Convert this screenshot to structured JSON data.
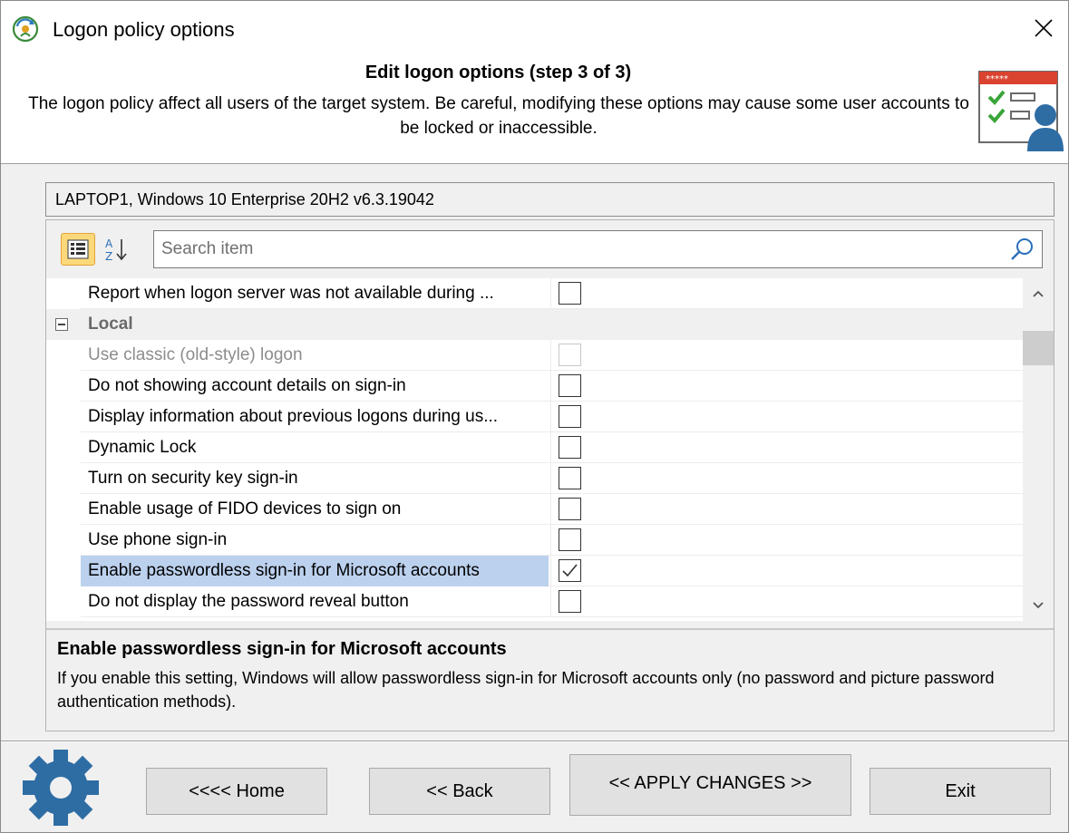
{
  "window": {
    "title": "Logon policy options"
  },
  "header": {
    "title": "Edit logon options (step 3 of 3)",
    "description": "The logon policy affect all users of the target system. Be careful, modifying these options may cause some user accounts to be locked or inaccessible."
  },
  "system_info": "LAPTOP1, Windows 10 Enterprise 20H2 v6.3.19042",
  "search": {
    "placeholder": "Search item",
    "value": ""
  },
  "rows": [
    {
      "label": "Report when logon server was not available during ...",
      "checked": false,
      "state": "normal"
    },
    {
      "label": "Local",
      "state": "category",
      "expanded": true
    },
    {
      "label": "Use classic (old-style) logon",
      "checked": false,
      "state": "disabled"
    },
    {
      "label": "Do not showing account details on sign-in",
      "checked": false,
      "state": "normal"
    },
    {
      "label": "Display information about previous logons during us...",
      "checked": false,
      "state": "normal"
    },
    {
      "label": "Dynamic Lock",
      "checked": false,
      "state": "normal"
    },
    {
      "label": "Turn on security key sign-in",
      "checked": false,
      "state": "normal"
    },
    {
      "label": "Enable usage of FIDO devices to sign on",
      "checked": false,
      "state": "normal"
    },
    {
      "label": "Use phone sign-in",
      "checked": false,
      "state": "normal"
    },
    {
      "label": "Enable passwordless sign-in for Microsoft accounts",
      "checked": true,
      "state": "selected"
    },
    {
      "label": "Do not display the password reveal button",
      "checked": false,
      "state": "normal"
    }
  ],
  "description_panel": {
    "title": "Enable passwordless sign-in for Microsoft accounts",
    "text": "If you enable this setting, Windows will allow passwordless sign-in for Microsoft accounts only (no password and picture password authentication methods)."
  },
  "buttons": {
    "home": "<<<< Home",
    "back": "<< Back",
    "apply": "<< APPLY CHANGES >>",
    "exit": "Exit"
  },
  "colors": {
    "selected_row": "#bcd1ee",
    "category_text": "#6a6a6a",
    "toolbar_active": "#fbd97a",
    "gear": "#2e6da4",
    "badge_red": "#d9432f"
  }
}
